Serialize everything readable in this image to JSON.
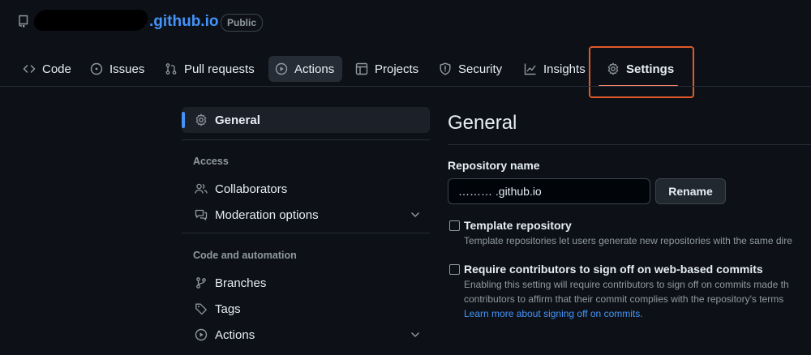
{
  "repo": {
    "name": ".github.io",
    "visibility": "Public"
  },
  "tabs": [
    {
      "label": "Code",
      "icon": "code-icon"
    },
    {
      "label": "Issues",
      "icon": "issue-icon"
    },
    {
      "label": "Pull requests",
      "icon": "pull-request-icon"
    },
    {
      "label": "Actions",
      "icon": "play-icon"
    },
    {
      "label": "Projects",
      "icon": "table-icon"
    },
    {
      "label": "Security",
      "icon": "shield-icon"
    },
    {
      "label": "Insights",
      "icon": "graph-icon"
    },
    {
      "label": "Settings",
      "icon": "gear-icon"
    }
  ],
  "sidebar": {
    "general": "General",
    "access_heading": "Access",
    "collaborators": "Collaborators",
    "moderation": "Moderation options",
    "code_heading": "Code and automation",
    "branches": "Branches",
    "tags": "Tags",
    "actions": "Actions"
  },
  "main": {
    "title": "General",
    "repo_name_label": "Repository name",
    "repo_name_value": "……… .github.io",
    "rename_button": "Rename",
    "template_label": "Template repository",
    "template_desc": "Template repositories let users generate new repositories with the same dire",
    "signoff_label": "Require contributors to sign off on web-based commits",
    "signoff_desc_1": "Enabling this setting will require contributors to sign off on commits made th",
    "signoff_desc_2": "contributors to affirm that their commit complies with the repository's terms",
    "signoff_link": "Learn more about signing off on commits."
  },
  "colors": {
    "background": "#0d1117",
    "accent_link": "#4493f8",
    "tab_underline": "#f78166",
    "highlight_box": "#e0592a"
  }
}
